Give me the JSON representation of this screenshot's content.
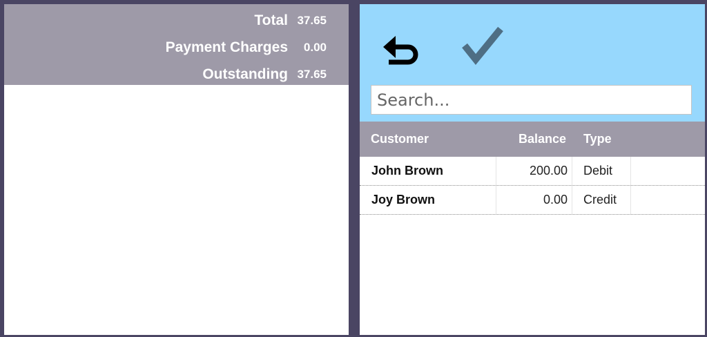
{
  "summary": {
    "rows": [
      {
        "label": "Total",
        "value": "37.65"
      },
      {
        "label": "Payment Charges",
        "value": "0.00"
      },
      {
        "label": "Outstanding",
        "value": "37.65"
      }
    ]
  },
  "toolbar": {
    "back_icon": "undo-arrow-icon",
    "confirm_icon": "checkmark-icon",
    "search_placeholder": "Search..."
  },
  "table": {
    "headers": {
      "customer": "Customer",
      "balance": "Balance",
      "type": "Type"
    },
    "rows": [
      {
        "customer": "John Brown",
        "balance": "200.00",
        "type": "Debit"
      },
      {
        "customer": "Joy Brown",
        "balance": "0.00",
        "type": "Credit"
      }
    ]
  },
  "colors": {
    "background": "#4a4563",
    "header_gray": "#9e9aa8",
    "toolbar_blue": "#97d8fd",
    "check_color": "#4e6e84"
  }
}
